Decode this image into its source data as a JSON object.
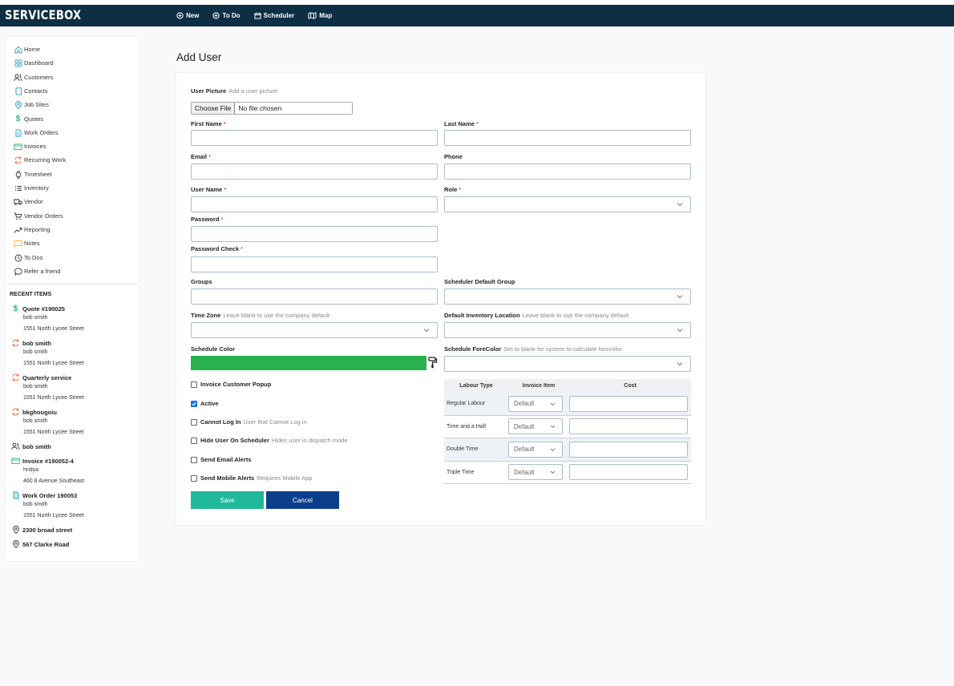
{
  "app": {
    "logo": "SERVICEBOX"
  },
  "topnav": {
    "new": "New",
    "todo": "To Do",
    "scheduler": "Scheduler",
    "map": "Map"
  },
  "sidebar": {
    "items": [
      {
        "label": "Home",
        "icon": "home-icon"
      },
      {
        "label": "Dashboard",
        "icon": "dashboard-icon"
      },
      {
        "label": "Customers",
        "icon": "users-icon"
      },
      {
        "label": "Contacts",
        "icon": "contact-card-icon"
      },
      {
        "label": "Job Sites",
        "icon": "location-pin-icon"
      },
      {
        "label": "Quotes",
        "icon": "dollar-icon"
      },
      {
        "label": "Work Orders",
        "icon": "document-icon"
      },
      {
        "label": "Invoices",
        "icon": "invoice-icon"
      },
      {
        "label": "Recurring Work",
        "icon": "recurring-icon"
      },
      {
        "label": "Timesheet",
        "icon": "watch-icon"
      },
      {
        "label": "Inventory",
        "icon": "list-icon"
      },
      {
        "label": "Vendor",
        "icon": "truck-icon"
      },
      {
        "label": "Vendor Orders",
        "icon": "cart-icon"
      },
      {
        "label": "Reporting",
        "icon": "trend-icon"
      },
      {
        "label": "Notes",
        "icon": "note-icon"
      },
      {
        "label": "To Dos",
        "icon": "clock-icon"
      },
      {
        "label": "Refer a friend",
        "icon": "chat-icon"
      }
    ]
  },
  "recent": {
    "title": "RECENT ITEMS",
    "items": [
      {
        "title": "Quote #190025",
        "icon": "dollar-icon",
        "sub": [
          "bob smith",
          "1551 North Lycee Street"
        ]
      },
      {
        "title": "bob smith",
        "icon": "recurring-icon",
        "sub": [
          "bob smith",
          "1551 North Lycee Street"
        ]
      },
      {
        "title": "Quarterly service",
        "icon": "recurring-icon",
        "sub": [
          "bob smith",
          "1551 North Lycee Street"
        ]
      },
      {
        "title": "bkghougoiu",
        "icon": "recurring-icon",
        "sub": [
          "bob smith",
          "1551 North Lycee Street"
        ]
      },
      {
        "title": "bob smith",
        "icon": "users-icon",
        "sub": []
      },
      {
        "title": "Invoice #190052-4",
        "icon": "invoice-icon",
        "sub": [
          "hridya",
          "460 8 Avenue Southeast"
        ]
      },
      {
        "title": "Work Order 190053",
        "icon": "document-icon",
        "sub": [
          "bob smith",
          "1551 North Lycee Street"
        ]
      },
      {
        "title": "2300 broad street",
        "icon": "location-pin-icon",
        "sub": []
      },
      {
        "title": "567 Clarke Road",
        "icon": "location-pin-icon",
        "sub": []
      }
    ]
  },
  "page": {
    "title": "Add User"
  },
  "form": {
    "user_picture": "User Picture",
    "user_picture_hint": "Add a user picture",
    "choose_file": "Choose File",
    "no_file": "No file chosen",
    "first_name": "First Name",
    "last_name": "Last Name",
    "email": "Email",
    "phone": "Phone",
    "user_name": "User Name",
    "role": "Role",
    "password": "Password",
    "password_check": "Password Check",
    "groups": "Groups",
    "scheduler_group": "Scheduler Default Group",
    "time_zone": "Time Zone",
    "time_zone_hint": "Leave blank to use the company default",
    "inventory_location": "Default Inventory Location",
    "inventory_location_hint": "Leave blank to use the company default",
    "schedule_color": "Schedule Color",
    "schedule_color_value": "#28b14c",
    "schedule_forecolor": "Schedule ForeColor",
    "schedule_forecolor_hint": "Set to blank for system to calculate forecolor",
    "required_mark": "*"
  },
  "checkboxes": [
    {
      "label": "Invoice Customer Popup",
      "hint": "",
      "checked": false
    },
    {
      "label": "Active",
      "hint": "",
      "checked": true
    },
    {
      "label": "Cannot Log In",
      "hint": "User that Cannot Log in",
      "checked": false
    },
    {
      "label": "Hide User On Scheduler",
      "hint": "Hides user in dispatch mode",
      "checked": false
    },
    {
      "label": "Send Email Alerts",
      "hint": "",
      "checked": false
    },
    {
      "label": "Send Mobile Alerts",
      "hint": "Requires Mobile App",
      "checked": false
    }
  ],
  "labour": {
    "headers": [
      "Labour Type",
      "Invoice Item",
      "Cost"
    ],
    "rows": [
      {
        "type": "Regular Labour",
        "item": "Default",
        "cost": ""
      },
      {
        "type": "Time and a Half",
        "item": "Default",
        "cost": ""
      },
      {
        "type": "Double Time",
        "item": "Default",
        "cost": ""
      },
      {
        "type": "Triple Time",
        "item": "Default",
        "cost": ""
      }
    ]
  },
  "actions": {
    "save": "Save",
    "cancel": "Cancel"
  },
  "colors": {
    "topbar": "#0d2f44",
    "save": "#1fb89a",
    "cancel": "#0b3f8e",
    "accent_orange": "#f0643c",
    "accent_teal": "#2a9fb6"
  }
}
